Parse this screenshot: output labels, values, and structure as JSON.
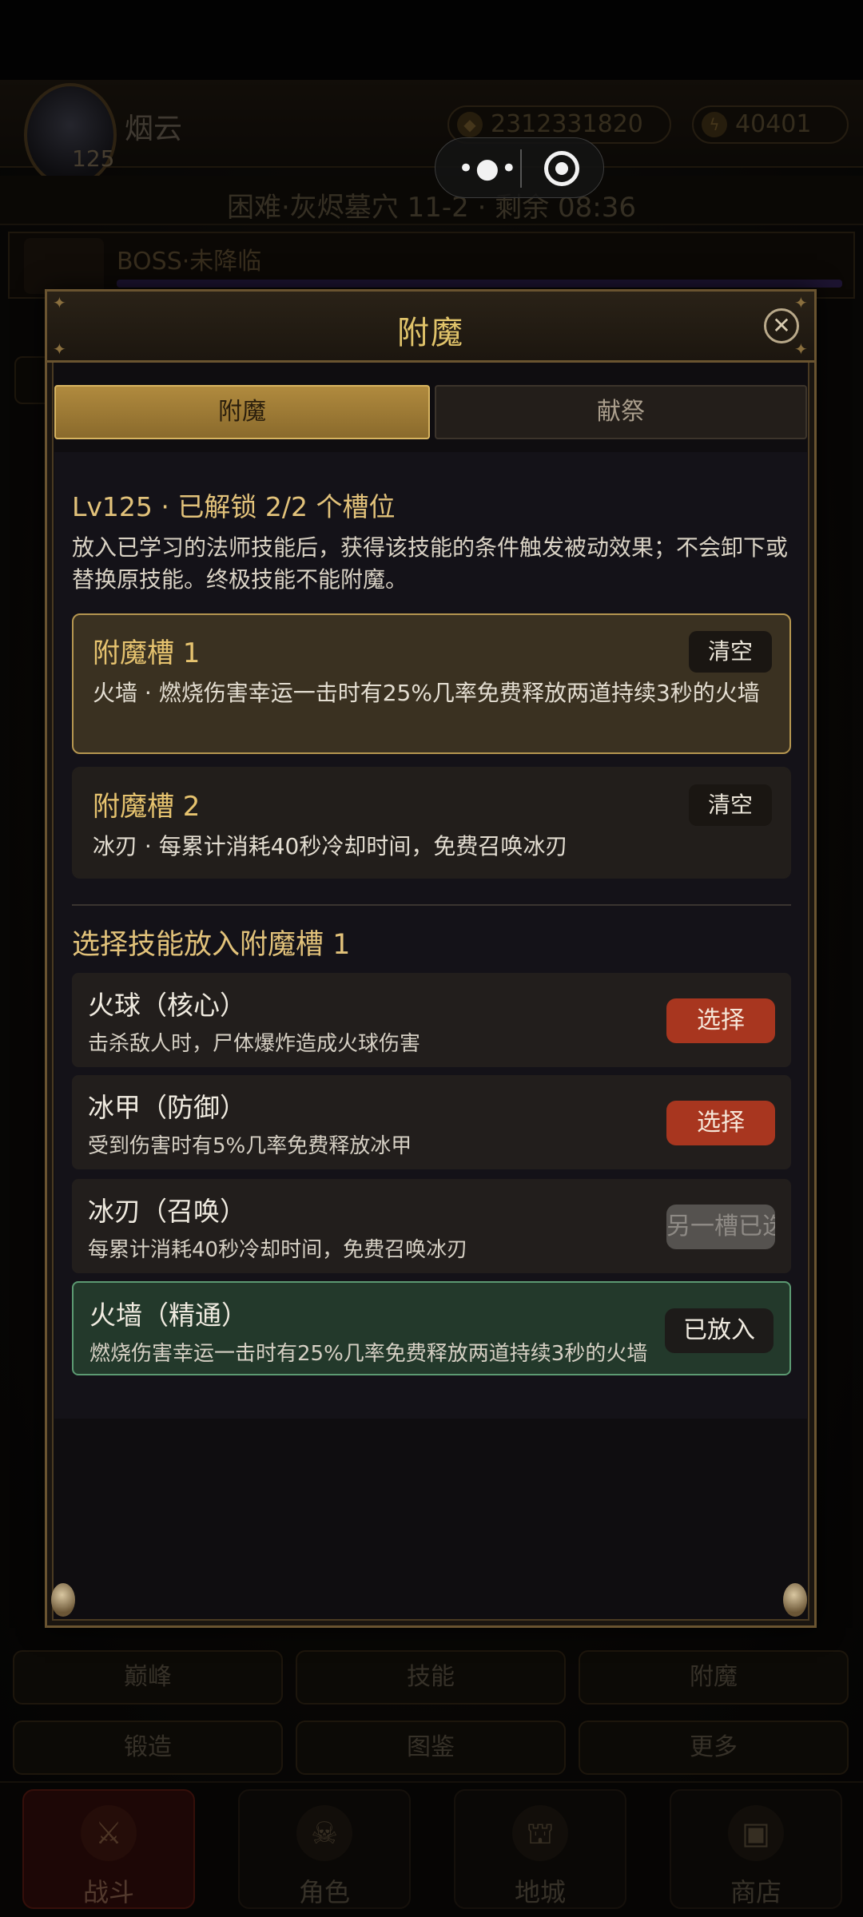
{
  "hud": {
    "player_name": "烟云",
    "level": "125",
    "gold": "2312331820",
    "energy": "40401",
    "stage": "困难·灰烬墓穴 11-2 · 剩余 08:36",
    "boss_status": "BOSS·未降临"
  },
  "capsule": {
    "more_icon": "more-dots-icon",
    "close_icon": "target-icon"
  },
  "modal": {
    "title": "附魔",
    "close_symbol": "✕",
    "tabs": [
      {
        "label": "附魔",
        "active": true
      },
      {
        "label": "献祭",
        "active": false
      }
    ],
    "level_line": "Lv125 · 已解锁 2/2 个槽位",
    "description": "放入已学习的法师技能后，获得该技能的条件触发被动效果；不会卸下或替换原技能。终极技能不能附魔。",
    "slots": [
      {
        "title": "附魔槽 1",
        "desc": "火墙 · 燃烧伤害幸运一击时有25%几率免费释放两道持续3秒的火墙",
        "clear_label": "清空",
        "selected": true
      },
      {
        "title": "附魔槽 2",
        "desc": "冰刃 · 每累计消耗40秒冷却时间，免费召唤冰刃",
        "clear_label": "清空",
        "selected": false
      }
    ],
    "section_title": "选择技能放入附魔槽 1",
    "skills": [
      {
        "name": "火球（核心）",
        "desc": "击杀敌人时，尸体爆炸造成火球伤害",
        "button": "选择",
        "state": "choose"
      },
      {
        "name": "冰甲（防御）",
        "desc": "受到伤害时有5%几率免费释放冰甲",
        "button": "选择",
        "state": "choose"
      },
      {
        "name": "冰刃（召唤）",
        "desc": "每累计消耗40秒冷却时间，免费召唤冰刃",
        "button": "另一槽已选",
        "state": "disabled"
      },
      {
        "name": "火墙（精通）",
        "desc": "燃烧伤害幸运一击时有25%几率免费释放两道持续3秒的火墙",
        "button": "已放入",
        "state": "placed"
      }
    ]
  },
  "bottom_buttons": [
    "巅峰",
    "技能",
    "附魔",
    "锻造",
    "图鉴",
    "更多"
  ],
  "tabbar": [
    {
      "label": "战斗",
      "icon": "crossed-swords-icon",
      "glyph": "⚔",
      "active": true
    },
    {
      "label": "角色",
      "icon": "skull-helmet-icon",
      "glyph": "☠",
      "active": false
    },
    {
      "label": "地城",
      "icon": "dungeon-gate-icon",
      "glyph": "⛫",
      "active": false
    },
    {
      "label": "商店",
      "icon": "chest-icon",
      "glyph": "▣",
      "active": false
    }
  ],
  "colors": {
    "accent_gold": "#e2c27a",
    "choose_button": "#a8361f",
    "placed_green": "#23392b"
  }
}
